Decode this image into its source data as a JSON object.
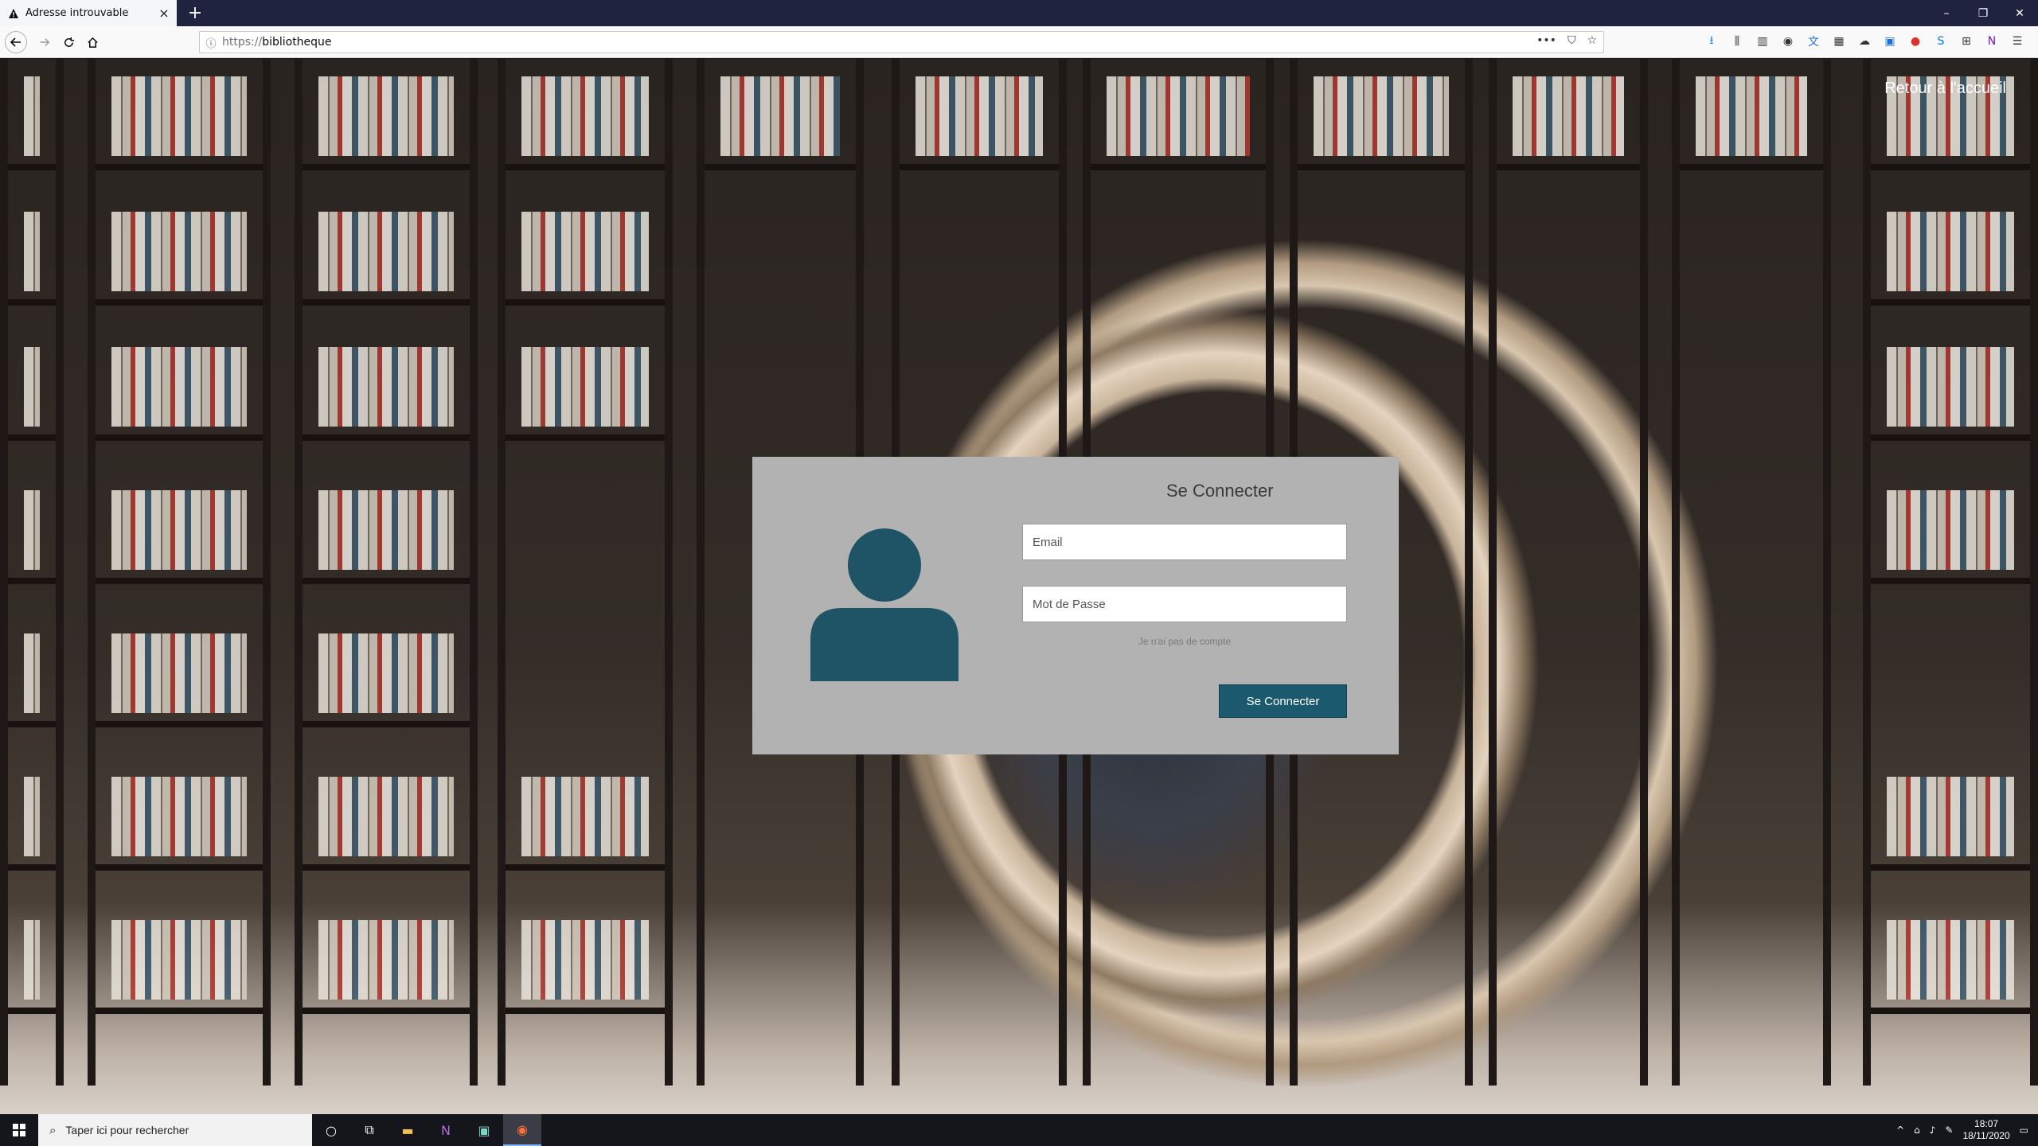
{
  "browser": {
    "tab_title": "Adresse introuvable",
    "tab_close": "×",
    "new_tab": "+",
    "url_protocol": "https://",
    "url_host": "bibliotheque",
    "url_menu": "•••",
    "window_controls": [
      "–",
      "❐",
      "✕"
    ]
  },
  "page": {
    "back_home": "Retour à l'accueil",
    "login": {
      "title": "Se Connecter",
      "email_placeholder": "Email",
      "password_placeholder": "Mot de Passe",
      "no_account": "Je n'ai pas de compte",
      "submit": "Se Connecter"
    }
  },
  "taskbar": {
    "search_placeholder": "Taper ici pour rechercher",
    "time": "18:07",
    "date": "18/11/2020"
  },
  "colors": {
    "accent": "#1b5a6e",
    "avatar": "#1e5466",
    "card": "#b2b2b2"
  }
}
